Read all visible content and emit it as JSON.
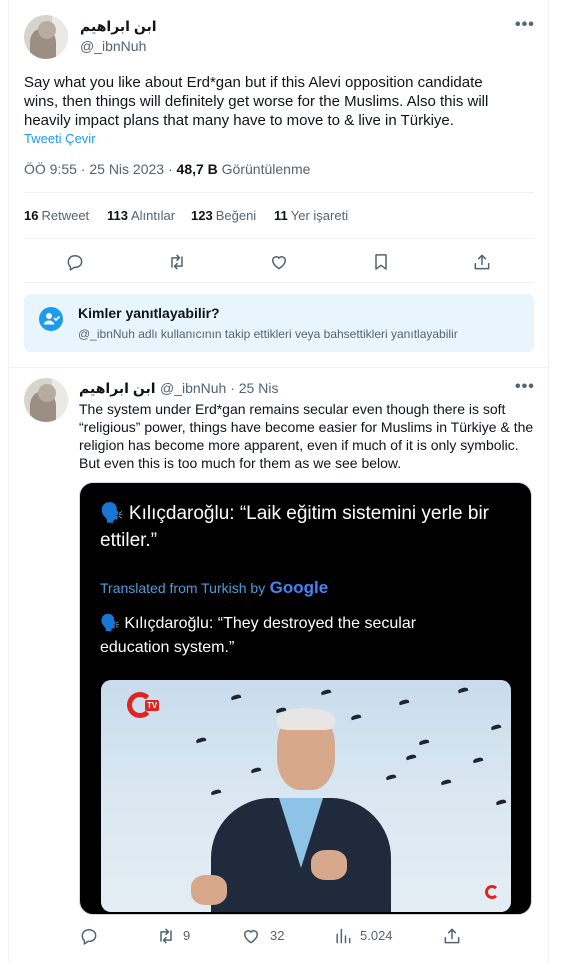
{
  "main_tweet": {
    "display_name": "ابن ابراهيم",
    "handle": "@_ibnNuh",
    "text_lines": [
      "Say what you like about Erd*gan but if this Alevi opposition candidate",
      "wins, then things will definitely get worse for the Muslims. Also this will",
      "heavily impact plans that many have to move to & live in Türkiye."
    ],
    "translate_label": "Tweeti Çevir",
    "timestamp": "ÖÖ 9:55 · 25 Nis 2023 ·",
    "views_count": "48,7 B",
    "views_label": "Görüntülenme",
    "stats": {
      "retweets_count": "16",
      "retweets_label": "Retweet",
      "quotes_count": "113",
      "quotes_label": "Alıntılar",
      "likes_count": "123",
      "likes_label": "Beğeni",
      "bookmarks_count": "11",
      "bookmarks_label": "Yer işareti"
    }
  },
  "reply_restriction": {
    "title": "Kimler yanıtlayabilir?",
    "subtitle": "@_ibnNuh adlı kullanıcının takip ettikleri veya bahsettikleri yanıtlayabilir"
  },
  "reply_tweet": {
    "display_name": "ابن ابراهيم",
    "handle_date": "@_ibnNuh · 25 Nis",
    "text_lines": [
      "The system under Erd*gan remains secular even though there is soft",
      "“religious” power, things have become easier for Muslims in Türkiye & the",
      "religion has become more apparent, even if much of it is only symbolic.",
      "But even this is too much for them as we see below."
    ],
    "media": {
      "line1": "🗣️ Kılıçdaroğlu: “Laik eğitim sistemini yerle bir",
      "line2": "ettiler.”",
      "translated_prefix": "Translated from Turkish by",
      "google": "Google",
      "line3": "🗣️ Kılıçdaroğlu: “They destroyed the secular",
      "line4": "education system.”",
      "tv_logo": "TV"
    },
    "actions": {
      "retweets": "9",
      "likes": "32",
      "views": "5.024"
    }
  },
  "colors": {
    "accent": "#1d9bf0",
    "secondary_text": "#536471",
    "reply_box_bg": "#e8f5fd"
  },
  "icons": [
    "more-icon",
    "reply-icon",
    "retweet-icon",
    "like-icon",
    "bookmark-icon",
    "share-icon",
    "person-check-icon",
    "views-icon"
  ]
}
